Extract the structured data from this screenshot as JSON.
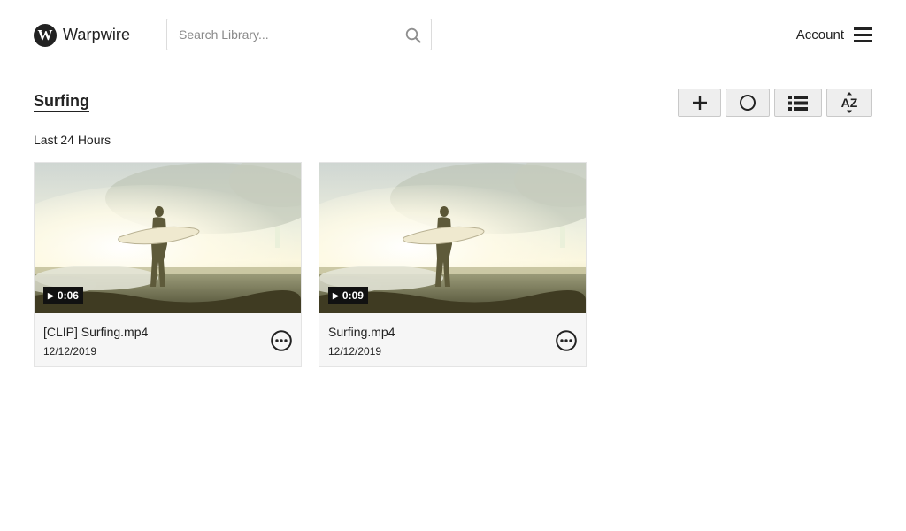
{
  "app": {
    "logo_letter": "W",
    "name": "Warpwire"
  },
  "search": {
    "placeholder": "Search Library...",
    "value": ""
  },
  "nav": {
    "account_label": "Account"
  },
  "page": {
    "title": "Surfing",
    "section_label": "Last 24 Hours"
  },
  "toolbar": {
    "sort_label": "AZ"
  },
  "videos": [
    {
      "title": "[CLIP] Surfing.mp4",
      "date": "12/12/2019",
      "duration": "0:06"
    },
    {
      "title": "Surfing.mp4",
      "date": "12/12/2019",
      "duration": "0:09"
    }
  ],
  "icons": {
    "play_glyph": "▶"
  },
  "colors": {
    "text": "#222222",
    "button_bg": "#eeeeee",
    "card_bg": "#f6f6f6",
    "duration_badge": "#111111"
  }
}
